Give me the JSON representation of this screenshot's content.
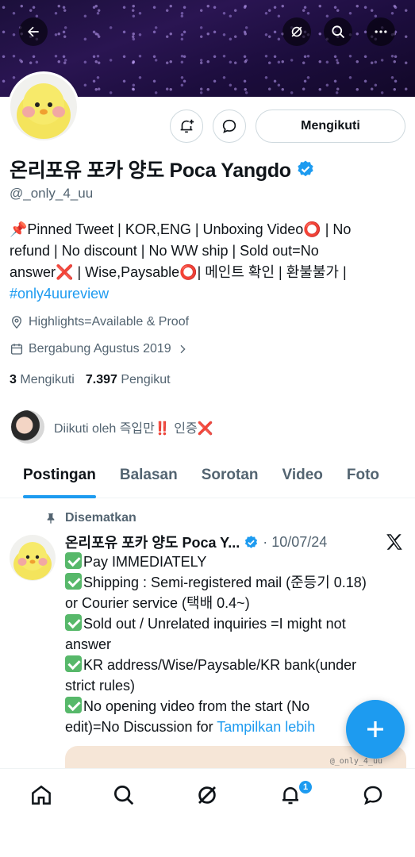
{
  "profile": {
    "name": "온리포유 포카 양도 Poca Yangdo",
    "handle": "@_only_4_uu",
    "follow_button": "Mengikuti",
    "bio_line1": "📌Pinned Tweet | KOR,ENG | Unboxing Video⭕ | No",
    "bio_line2": "refund | No discount | No WW ship | Sold out=No",
    "bio_line3": "answer❌ | Wise,Paysable⭕| 메인트 확인 | 환불불가 |",
    "bio_hashtag": "#only4uureview",
    "highlights": "Highlights=Available & Proof",
    "joined": "Bergabung Agustus 2019",
    "following_count": "3",
    "following_label": "Mengikuti",
    "followers_count": "7.397",
    "followers_label": "Pengikut",
    "followed_by": "Diikuti oleh 즉입만‼️ 인증❌"
  },
  "tabs": [
    "Postingan",
    "Balasan",
    "Sorotan",
    "Video",
    "Foto"
  ],
  "post": {
    "pinned_label": "Disematkan",
    "author": "온리포유 포카 양도 Poca Y...",
    "date": "10/07/24",
    "line1": "Pay IMMEDIATELY",
    "line2": "Shipping : Semi-registered mail (준등기 0.18)",
    "line3": "or Courier service (택배 0.4~)",
    "line4": "Sold out / Unrelated inquiries =I might not",
    "line5": "answer",
    "line6": "KR address/Wise/Paysable/KR bank(under",
    "line7": "strict rules)",
    "line8": "No opening video from the start (No",
    "line9": "edit)=No Discussion for ",
    "show_more": "Tampilkan lebih",
    "watermark": "@_only_4_uu"
  },
  "nav": {
    "notification_badge": "1"
  },
  "colors": {
    "accent": "#1d9bf0",
    "text": "#0f1419",
    "muted": "#536471"
  }
}
